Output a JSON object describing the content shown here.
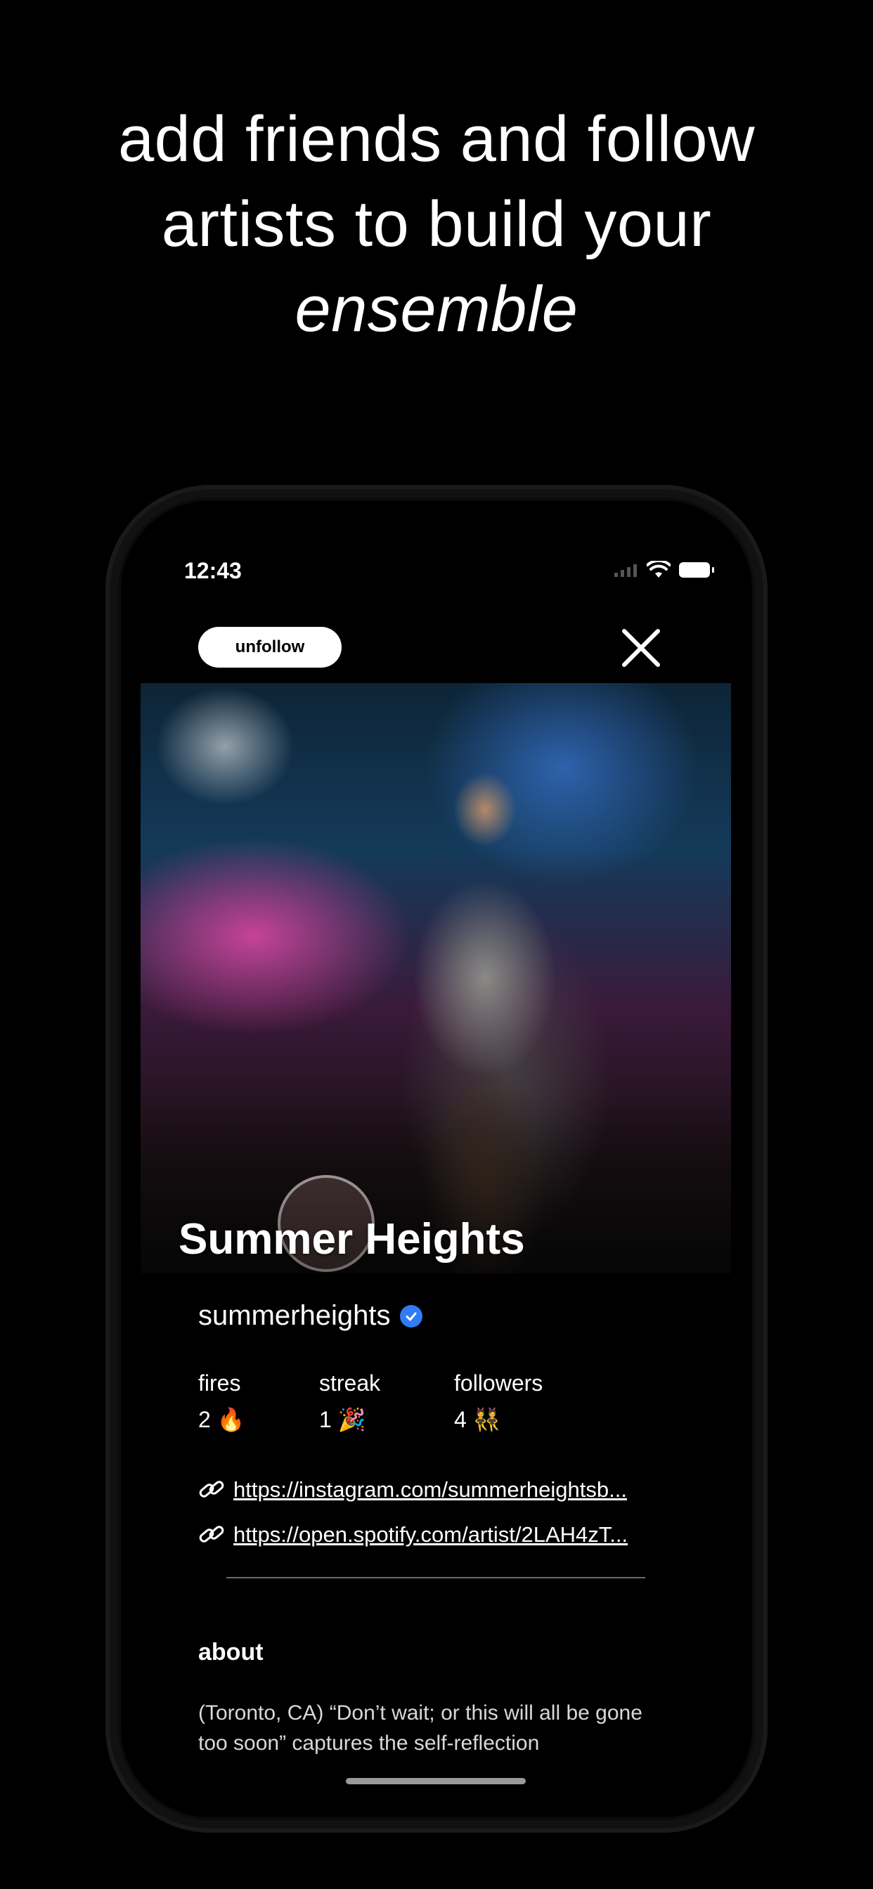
{
  "headline": {
    "line1": "add friends and follow",
    "line2": "artists to build your",
    "line3": "ensemble"
  },
  "status_bar": {
    "time": "12:43"
  },
  "profile": {
    "unfollow_label": "unfollow",
    "artist_name": "Summer Heights",
    "handle": "summerheights",
    "stats": [
      {
        "label": "fires",
        "value": "2 🔥"
      },
      {
        "label": "streak",
        "value": "1 🎉"
      },
      {
        "label": "followers",
        "value": "4 👯"
      }
    ],
    "links": [
      {
        "text": "https://instagram.com/summerheightsb..."
      },
      {
        "text": "https://open.spotify.com/artist/2LAH4zT..."
      }
    ],
    "about_title": "about",
    "about_text": "(Toronto, CA) “Don’t wait; or this will all be gone too soon” captures the self-reflection"
  },
  "icons": {
    "close": "close-icon",
    "verified": "verified-badge-icon",
    "link": "link-icon",
    "wifi": "wifi-icon",
    "battery": "battery-icon",
    "signal": "cellular-signal-icon"
  },
  "colors": {
    "background": "#000000",
    "verified": "#2f7cf6",
    "button_bg": "#ffffff"
  }
}
